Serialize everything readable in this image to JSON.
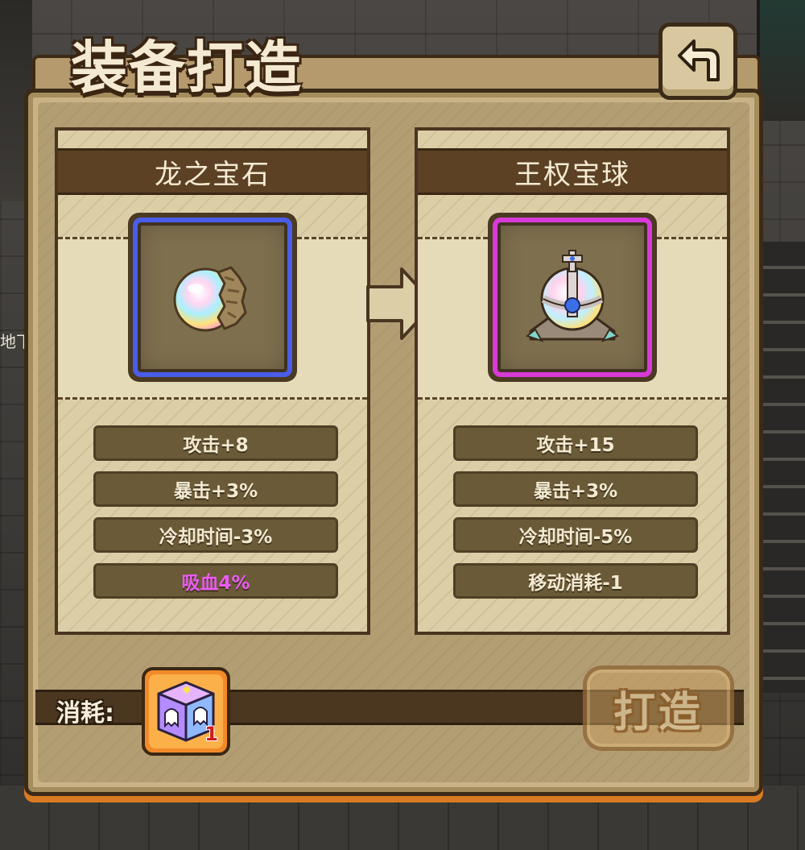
{
  "window": {
    "title": "装备打造"
  },
  "background": {
    "side_text": "地下"
  },
  "buttons": {
    "back_icon": "return-arrow-icon",
    "forge_label": "打造"
  },
  "items": [
    {
      "name": "龙之宝石",
      "icon": "rainbow-dragon-gem-icon",
      "quality_color": "#4a5de8",
      "stats": [
        {
          "text": "攻击+8",
          "color": "#f3ead2"
        },
        {
          "text": "暴击+3%",
          "color": "#f3ead2"
        },
        {
          "text": "冷却时间-3%",
          "color": "#f3ead2"
        },
        {
          "text": "吸血4%",
          "color": "#e85cf0"
        }
      ]
    },
    {
      "name": "王权宝球",
      "icon": "royal-orb-icon",
      "quality_color": "#d83ad8",
      "stats": [
        {
          "text": "攻击+15",
          "color": "#f3ead2"
        },
        {
          "text": "暴击+3%",
          "color": "#f3ead2"
        },
        {
          "text": "冷却时间-5%",
          "color": "#f3ead2"
        },
        {
          "text": "移动消耗-1",
          "color": "#f3ead2"
        }
      ]
    }
  ],
  "cost": {
    "label": "消耗:",
    "item_icon": "rainbow-ghost-cube-icon",
    "count": "1"
  },
  "colors": {
    "panel": "#c9b286",
    "card": "#dccfa8",
    "header": "#5c4125",
    "stat_bg": "#6b5a37",
    "accent_orange": "#f28a2a"
  }
}
